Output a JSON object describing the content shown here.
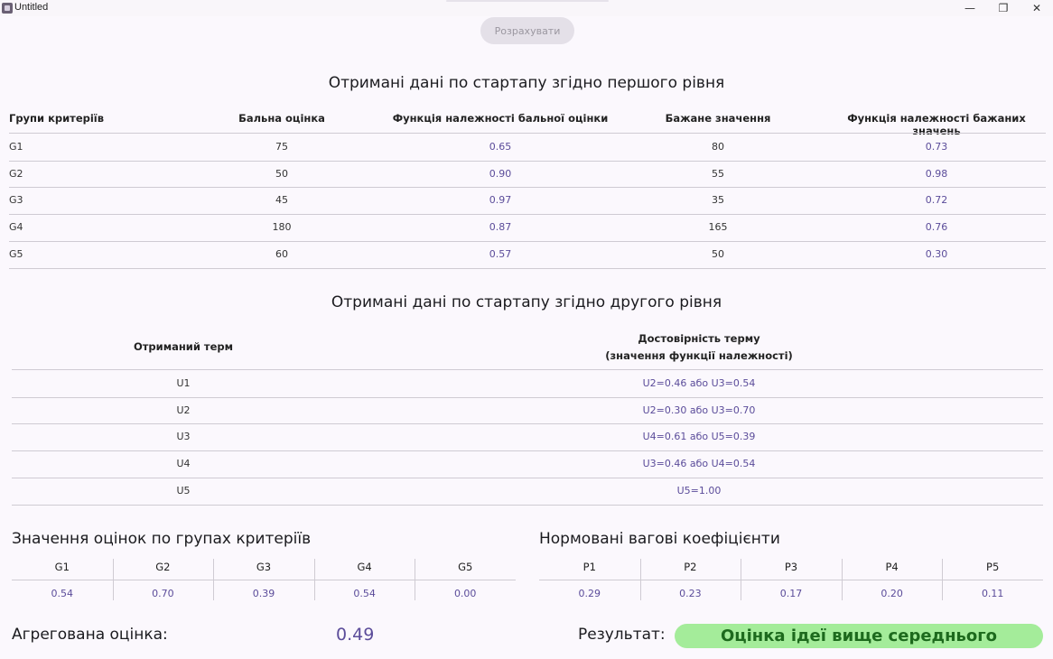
{
  "window": {
    "title": "Untitled",
    "minimize": "—",
    "maximize": "❐",
    "close": "✕"
  },
  "calculate_button": "Розрахувати",
  "level1": {
    "title": "Отримані дані по стартапу згідно першого рівня",
    "headers": [
      "Групи критеріїв",
      "Бальна оцінка",
      "Функція належності бальної оцінки",
      "Бажане значення",
      "Функція належності бажаних значень"
    ],
    "rows": [
      [
        "G1",
        "75",
        "0.65",
        "80",
        "0.73"
      ],
      [
        "G2",
        "50",
        "0.90",
        "55",
        "0.98"
      ],
      [
        "G3",
        "45",
        "0.97",
        "35",
        "0.72"
      ],
      [
        "G4",
        "180",
        "0.87",
        "165",
        "0.76"
      ],
      [
        "G5",
        "60",
        "0.57",
        "50",
        "0.30"
      ]
    ]
  },
  "level2": {
    "title": "Отримані дані по стартапу згідно другого рівня",
    "header_term": "Отриманий терм",
    "header_reliability_1": "Достовірність терму",
    "header_reliability_2": "(значення функції належності)",
    "rows": [
      [
        "U1",
        "U2=0.46 або U3=0.54"
      ],
      [
        "U2",
        "U2=0.30 або U3=0.70"
      ],
      [
        "U3",
        "U4=0.61 або U5=0.39"
      ],
      [
        "U4",
        "U3=0.46 або U4=0.54"
      ],
      [
        "U5",
        "U5=1.00"
      ]
    ]
  },
  "group_scores": {
    "title": "Значення оцінок по групах критеріїв",
    "headers": [
      "G1",
      "G2",
      "G3",
      "G4",
      "G5"
    ],
    "values": [
      "0.54",
      "0.70",
      "0.39",
      "0.54",
      "0.00"
    ]
  },
  "weights": {
    "title": "Нормовані вагові коефіцієнти",
    "headers": [
      "P1",
      "P2",
      "P3",
      "P4",
      "P5"
    ],
    "values": [
      "0.29",
      "0.23",
      "0.17",
      "0.20",
      "0.11"
    ]
  },
  "aggregate": {
    "label": "Агрегована оцінка:",
    "value": "0.49"
  },
  "result": {
    "label": "Результат:",
    "value": "Оцінка ідеї вище середнього",
    "color": "#a4ec9a"
  }
}
